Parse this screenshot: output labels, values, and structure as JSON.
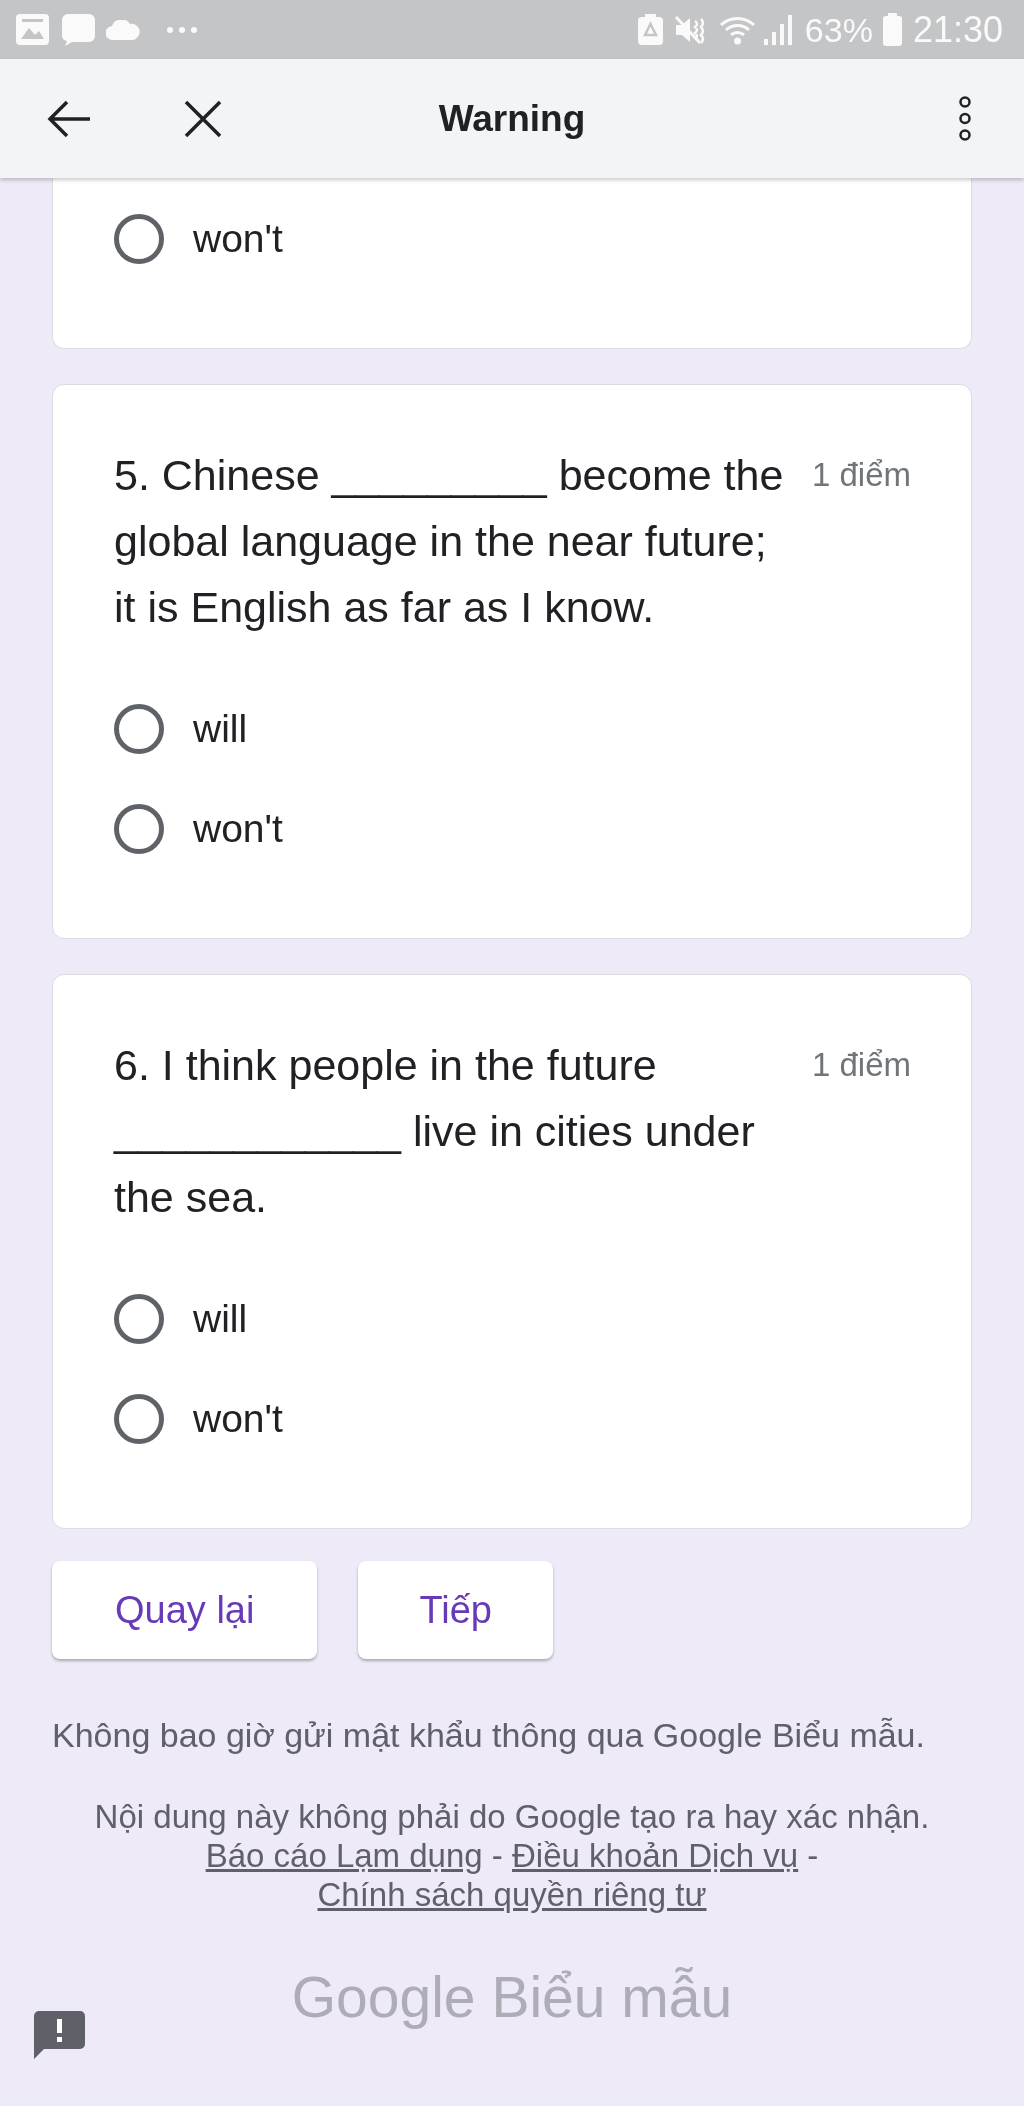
{
  "status_bar": {
    "battery": "63%",
    "time": "21:30"
  },
  "app_bar": {
    "title": "Warning"
  },
  "questions": [
    {
      "cut_off": true,
      "options": [
        {
          "label": "won't",
          "selected": false
        }
      ]
    },
    {
      "cut_off": false,
      "text": "5. Chinese _________ become the\nglobal language in the near future;\nit is English as far as I know.",
      "points": "1 điểm",
      "options": [
        {
          "label": "will",
          "selected": false
        },
        {
          "label": "won't",
          "selected": false
        }
      ]
    },
    {
      "cut_off": false,
      "text": "6. I think people in the future\n____________ live in cities under\nthe sea.",
      "points": "1 điểm",
      "options": [
        {
          "label": "will",
          "selected": false
        },
        {
          "label": "won't",
          "selected": false
        }
      ]
    }
  ],
  "nav_buttons": [
    {
      "label": "Quay lại"
    },
    {
      "label": "Tiếp"
    }
  ],
  "footer": {
    "notice": "Không bao giờ gửi mật khẩu thông qua Google Biểu mẫu.",
    "disclaimer": "Nội dung này không phải do Google tạo ra hay xác nhận.",
    "links": [
      {
        "label": "Báo cáo Lạm dụng"
      },
      {
        "label": "Điều khoản Dịch vụ"
      },
      {
        "label": "Chính sách quyền riêng tư"
      }
    ],
    "separators": [
      "-",
      "-"
    ]
  },
  "logo": "Google Biểu mẫu"
}
